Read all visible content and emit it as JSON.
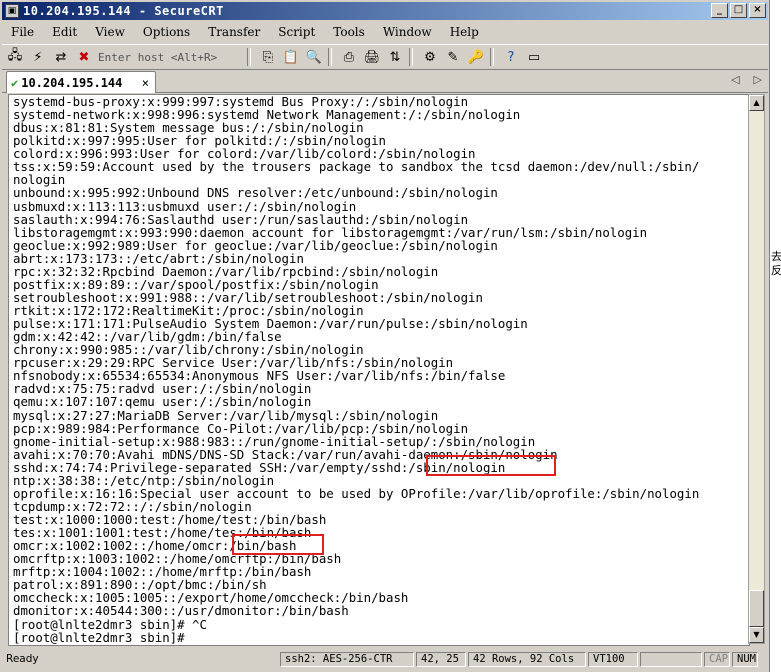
{
  "window": {
    "title": "10.204.195.144 - SecureCRT"
  },
  "menu": [
    "File",
    "Edit",
    "View",
    "Options",
    "Transfer",
    "Script",
    "Tools",
    "Window",
    "Help"
  ],
  "toolbar": {
    "host_placeholder": "Enter host <Alt+R>"
  },
  "tab": {
    "label": "10.204.195.144",
    "close": "×"
  },
  "terminal": {
    "lines": [
      "systemd-bus-proxy:x:999:997:systemd Bus Proxy:/:/sbin/nologin",
      "systemd-network:x:998:996:systemd Network Management:/:/sbin/nologin",
      "dbus:x:81:81:System message bus:/:/sbin/nologin",
      "polkitd:x:997:995:User for polkitd:/:/sbin/nologin",
      "colord:x:996:993:User for colord:/var/lib/colord:/sbin/nologin",
      "tss:x:59:59:Account used by the trousers package to sandbox the tcsd daemon:/dev/null:/sbin/",
      "nologin",
      "unbound:x:995:992:Unbound DNS resolver:/etc/unbound:/sbin/nologin",
      "usbmuxd:x:113:113:usbmuxd user:/:/sbin/nologin",
      "saslauth:x:994:76:Saslauthd user:/run/saslauthd:/sbin/nologin",
      "libstoragemgmt:x:993:990:daemon account for libstoragemgmt:/var/run/lsm:/sbin/nologin",
      "geoclue:x:992:989:User for geoclue:/var/lib/geoclue:/sbin/nologin",
      "abrt:x:173:173::/etc/abrt:/sbin/nologin",
      "rpc:x:32:32:Rpcbind Daemon:/var/lib/rpcbind:/sbin/nologin",
      "postfix:x:89:89::/var/spool/postfix:/sbin/nologin",
      "setroubleshoot:x:991:988::/var/lib/setroubleshoot:/sbin/nologin",
      "rtkit:x:172:172:RealtimeKit:/proc:/sbin/nologin",
      "pulse:x:171:171:PulseAudio System Daemon:/var/run/pulse:/sbin/nologin",
      "gdm:x:42:42::/var/lib/gdm:/bin/false",
      "chrony:x:990:985::/var/lib/chrony:/sbin/nologin",
      "rpcuser:x:29:29:RPC Service User:/var/lib/nfs:/sbin/nologin",
      "nfsnobody:x:65534:65534:Anonymous NFS User:/var/lib/nfs:/bin/false",
      "radvd:x:75:75:radvd user:/:/sbin/nologin",
      "qemu:x:107:107:qemu user:/:/sbin/nologin",
      "mysql:x:27:27:MariaDB Server:/var/lib/mysql:/sbin/nologin",
      "pcp:x:989:984:Performance Co-Pilot:/var/lib/pcp:/sbin/nologin",
      "gnome-initial-setup:x:988:983::/run/gnome-initial-setup/:/sbin/nologin",
      "avahi:x:70:70:Avahi mDNS/DNS-SD Stack:/var/run/avahi-daemon:/sbin/nologin",
      "sshd:x:74:74:Privilege-separated SSH:/var/empty/sshd:/sbin/nologin",
      "ntp:x:38:38::/etc/ntp:/sbin/nologin",
      "oprofile:x:16:16:Special user account to be used by OProfile:/var/lib/oprofile:/sbin/nologin",
      "tcpdump:x:72:72::/:/sbin/nologin",
      "test:x:1000:1000:test:/home/test:/bin/bash",
      "tes:x:1001:1001:test:/home/tes:/bin/bash",
      "omcr:x:1002:1002::/home/omcr:/bin/bash",
      "omcrftp:x:1003:1002::/home/omcrftp:/bin/bash",
      "mrftp:x:1004:1002::/home/mrftp:/bin/bash",
      "patrol:x:891:890::/opt/bmc:/bin/sh",
      "omccheck:x:1005:1005::/export/home/omccheck:/bin/bash",
      "dmonitor:x:40544:300::/usr/dmonitor:/bin/bash",
      "[root@lnlte2dmr3 sbin]# ^C",
      "[root@lnlte2dmr3 sbin]# "
    ]
  },
  "status": {
    "ready": "Ready",
    "cipher": "ssh2: AES-256-CTR",
    "cursor": "42,  25",
    "size": "42 Rows, 92 Cols",
    "term": "VT100",
    "cap": "CAP",
    "num": "NUM"
  },
  "side_fragment": "去 反"
}
